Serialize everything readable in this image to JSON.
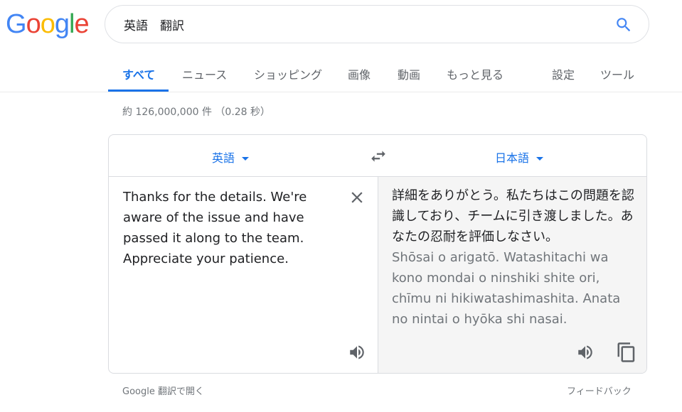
{
  "logo": {
    "letters": [
      "G",
      "o",
      "o",
      "g",
      "l",
      "e"
    ],
    "colors": [
      "#4285F4",
      "#EA4335",
      "#FBBC05",
      "#4285F4",
      "#34A853",
      "#EA4335"
    ]
  },
  "search": {
    "query": "英語　翻訳",
    "icon": "search-icon"
  },
  "tabs": [
    {
      "label": "すべて",
      "active": true
    },
    {
      "label": "ニュース"
    },
    {
      "label": "ショッピング"
    },
    {
      "label": "画像"
    },
    {
      "label": "動画"
    },
    {
      "label": "もっと見る"
    },
    {
      "label": "設定"
    },
    {
      "label": "ツール"
    }
  ],
  "result_stats": "約 126,000,000 件 （0.28 秒）",
  "translator": {
    "source_lang": "英語",
    "target_lang": "日本語",
    "source_text": "Thanks for the details. We're\naware of the issue and have\npassed it along to the team.\nAppreciate your patience.",
    "target_text": "詳細をありがとう。私たちはこの問題を認識しており、チームに引き渡しました。あなたの忍耐を評価しなさい。",
    "romanization": "Shōsai o arigatō. Watashitachi wa kono mondai o ninshiki shite ori, chīmu ni hikiwatashimashita. Anata no nintai o hyōka shi nasai.",
    "icons": [
      "swap-icon",
      "close-icon",
      "speaker-icon",
      "copy-icon"
    ]
  },
  "footer": {
    "open_link": "Google 翻訳で開く",
    "feedback": "フィードバック"
  },
  "colors": {
    "accent": "#1a73e8",
    "muted": "#70757a",
    "target_bg": "#f5f5f5"
  }
}
